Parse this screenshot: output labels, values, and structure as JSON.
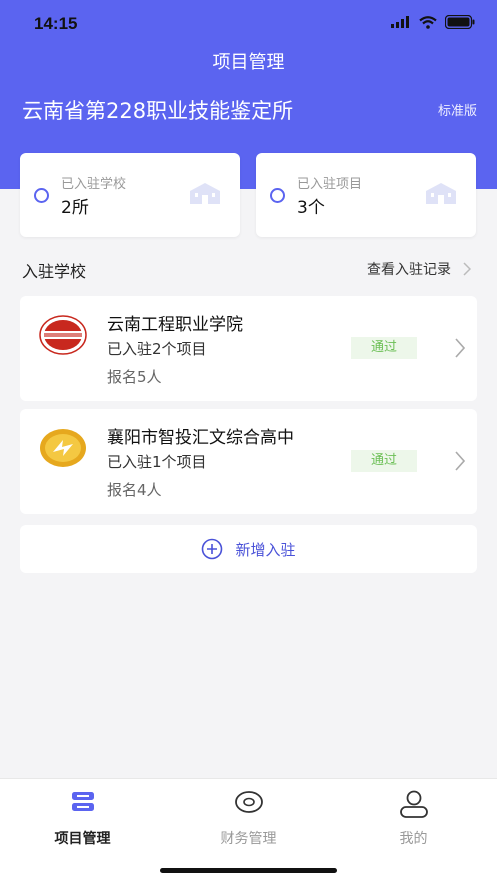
{
  "status_bar": {
    "time": "14:15"
  },
  "header": {
    "nav_title": "项目管理",
    "org_name": "云南省第228职业技能鉴定所",
    "version_label": "标准版"
  },
  "stats": [
    {
      "label": "已入驻学校",
      "value": "2所"
    },
    {
      "label": "已入驻项目",
      "value": "3个"
    }
  ],
  "section": {
    "title": "入驻学校",
    "link_label": "查看入驻记录"
  },
  "schools": [
    {
      "name": "云南工程职业学院",
      "projects": "已入驻2个项目",
      "signups": "报名5人",
      "status": "通过",
      "logo_icon": "college-seal-red"
    },
    {
      "name": "襄阳市智投汇文综合高中",
      "projects": "已入驻1个项目",
      "signups": "报名4人",
      "status": "通过",
      "logo_icon": "school-seal-gold"
    }
  ],
  "add_button": {
    "label": "新增入驻"
  },
  "tabbar": {
    "items": [
      {
        "label": "项目管理",
        "icon": "project-list-icon",
        "active": true
      },
      {
        "label": "财务管理",
        "icon": "finance-coin-icon",
        "active": false
      },
      {
        "label": "我的",
        "icon": "person-icon",
        "active": false
      }
    ]
  },
  "colors": {
    "accent": "#5b64f0",
    "badge_bg": "#edf7ea",
    "badge_text": "#6bbf55"
  }
}
